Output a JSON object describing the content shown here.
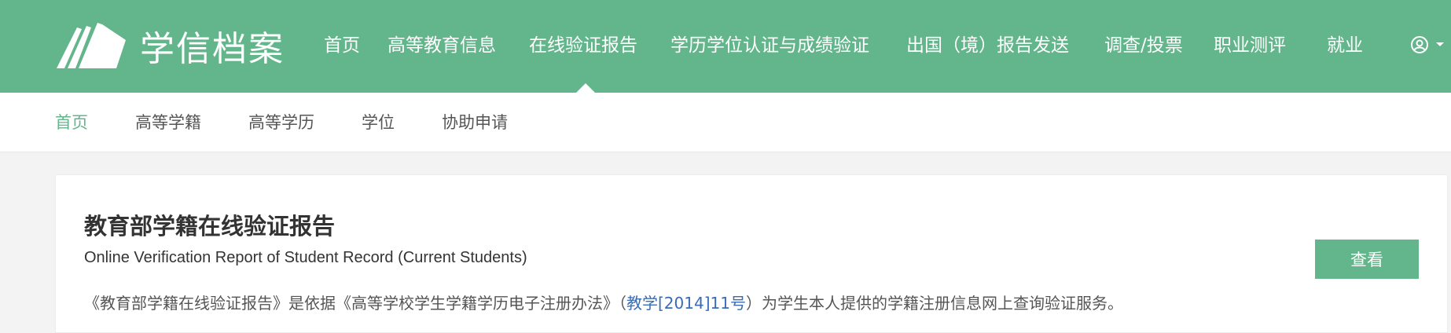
{
  "header": {
    "logo_text": "学信档案",
    "nav": [
      {
        "label": "首页"
      },
      {
        "label": "高等教育信息"
      },
      {
        "label": "在线验证报告"
      },
      {
        "label": "学历学位认证与成绩验证"
      },
      {
        "label": "出国（境）报告发送"
      },
      {
        "label": "调查/投票"
      },
      {
        "label": "职业测评"
      },
      {
        "label": "就业"
      }
    ],
    "active_nav": "在线验证报告",
    "user_icon": "user-circle-icon"
  },
  "subnav": {
    "items": [
      {
        "label": "首页"
      },
      {
        "label": "高等学籍"
      },
      {
        "label": "高等学历"
      },
      {
        "label": "学位"
      },
      {
        "label": "协助申请"
      }
    ],
    "active_item": "首页"
  },
  "card": {
    "title": "教育部学籍在线验证报告",
    "subtitle": "Online Verification Report of Student Record (Current Students)",
    "desc_before": "《教育部学籍在线验证报告》是依据《高等学校学生学籍学历电子注册办法》（",
    "desc_link": "教学[2014]11号",
    "desc_after": "）为学生本人提供的学籍注册信息网上查询验证服务。",
    "button_label": "查看"
  },
  "colors": {
    "brand_green": "#63b68b",
    "link_blue": "#3a6bb5"
  }
}
